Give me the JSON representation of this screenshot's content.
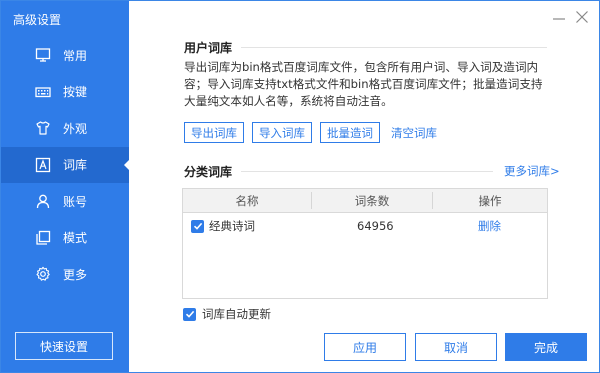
{
  "app": {
    "title": "高级设置"
  },
  "sidebar": {
    "items": [
      {
        "label": "常用",
        "icon": "monitor-icon"
      },
      {
        "label": "按键",
        "icon": "keyboard-icon"
      },
      {
        "label": "外观",
        "icon": "shirt-icon"
      },
      {
        "label": "词库",
        "icon": "dictionary-icon",
        "active": true
      },
      {
        "label": "账号",
        "icon": "user-icon"
      },
      {
        "label": "模式",
        "icon": "layers-icon"
      },
      {
        "label": "更多",
        "icon": "gear-icon"
      }
    ],
    "quick_settings": "快速设置"
  },
  "user_dict": {
    "title": "用户词库",
    "description": "导出词库为bin格式百度词库文件，包含所有用户词、导入词及造词内容；导入词库支持txt格式文件和bin格式百度词库文件；批量造词支持大量纯文本如人名等，系统将自动注音。",
    "export_label": "导出词库",
    "import_label": "导入词库",
    "batch_label": "批量造词",
    "clear_label": "清空词库"
  },
  "category_dict": {
    "title": "分类词库",
    "more_link": "更多词库>",
    "columns": [
      "名称",
      "词条数",
      "操作"
    ],
    "rows": [
      {
        "checked": true,
        "name": "经典诗词",
        "count": "64956",
        "action": "删除"
      }
    ]
  },
  "auto_update": {
    "checked": true,
    "label": "词库自动更新"
  },
  "footer": {
    "apply": "应用",
    "cancel": "取消",
    "done": "完成"
  },
  "colors": {
    "accent": "#2f7ce8",
    "sidebar_active": "#2369cf"
  }
}
